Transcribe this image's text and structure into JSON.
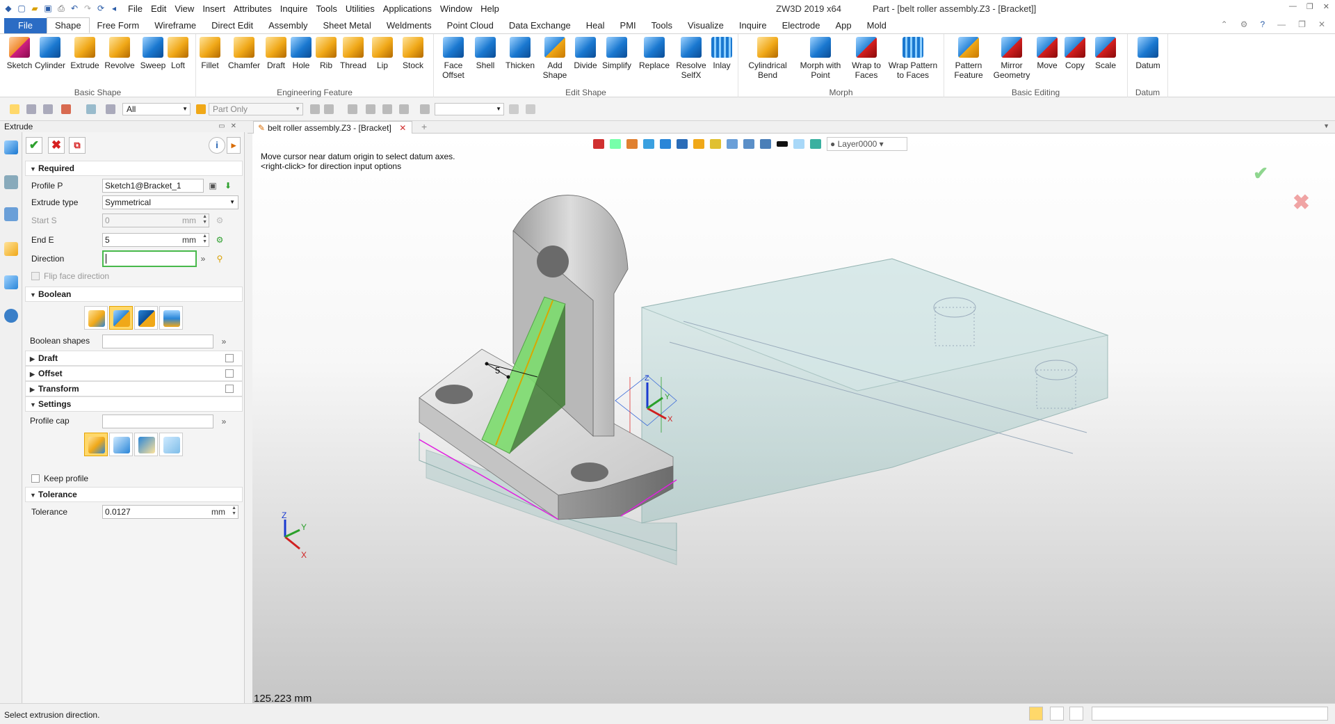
{
  "titlebar": {
    "menus": [
      "File",
      "Edit",
      "View",
      "Insert",
      "Attributes",
      "Inquire",
      "Tools",
      "Utilities",
      "Applications",
      "Window",
      "Help"
    ],
    "app": "ZW3D 2019  x64",
    "document": "Part - [belt roller assembly.Z3 - [Bracket]]"
  },
  "ribbon_tabs": {
    "file": "File",
    "items": [
      "Shape",
      "Free Form",
      "Wireframe",
      "Direct Edit",
      "Assembly",
      "Sheet Metal",
      "Weldments",
      "Point Cloud",
      "Data Exchange",
      "Heal",
      "PMI",
      "Tools",
      "Visualize",
      "Inquire",
      "Electrode",
      "App",
      "Mold"
    ]
  },
  "ribbon": {
    "basic_shape": {
      "label": "Basic Shape",
      "buttons": [
        "Sketch",
        "Cylinder",
        "Extrude",
        "Revolve",
        "Sweep",
        "Loft"
      ]
    },
    "engineering": {
      "label": "Engineering Feature",
      "buttons": [
        "Fillet",
        "Chamfer",
        "Draft",
        "Hole",
        "Rib",
        "Thread",
        "Lip",
        "Stock"
      ]
    },
    "edit_shape": {
      "label": "Edit Shape",
      "buttons": [
        [
          "Face",
          "Offset"
        ],
        [
          "Shell",
          ""
        ],
        [
          "Thicken",
          ""
        ],
        [
          "Add",
          "Shape"
        ],
        [
          "Divide",
          ""
        ],
        [
          "Simplify",
          ""
        ],
        [
          "Replace",
          ""
        ],
        [
          "Resolve",
          "SelfX"
        ],
        [
          "Inlay",
          ""
        ]
      ]
    },
    "morph": {
      "label": "Morph",
      "buttons": [
        [
          "Cylindrical",
          "Bend"
        ],
        [
          "Morph with",
          "Point"
        ],
        [
          "Wrap to",
          "Faces"
        ],
        [
          "Wrap Pattern",
          "to Faces"
        ]
      ]
    },
    "basic_editing": {
      "label": "Basic Editing",
      "buttons": [
        [
          "Pattern",
          "Feature"
        ],
        [
          "Mirror",
          "Geometry"
        ],
        [
          "Move",
          ""
        ],
        [
          "Copy",
          ""
        ],
        [
          "Scale",
          ""
        ]
      ]
    },
    "datum": {
      "label": "Datum",
      "buttons": [
        [
          "Datum",
          ""
        ]
      ]
    }
  },
  "toolbar2": {
    "filter": "All",
    "scope": "Part Only"
  },
  "panel": {
    "title": "Extrude",
    "required": {
      "header": "Required",
      "profile_label": "Profile P",
      "profile_value": "Sketch1@Bracket_1",
      "type_label": "Extrude type",
      "type_value": "Symmetrical",
      "start_label": "Start S",
      "start_value": "0",
      "start_unit": "mm",
      "end_label": "End E",
      "end_value": "5",
      "end_unit": "mm",
      "direction_label": "Direction",
      "direction_value": "",
      "flip_label": "Flip face direction"
    },
    "boolean": {
      "header": "Boolean",
      "shapes_label": "Boolean shapes"
    },
    "draft": "Draft",
    "offset": "Offset",
    "transform": "Transform",
    "settings": {
      "header": "Settings",
      "cap_label": "Profile cap",
      "keep_label": "Keep profile"
    },
    "tolerance": {
      "header": "Tolerance",
      "label": "Tolerance",
      "value": "0.0127",
      "unit": "mm"
    }
  },
  "doc_tab": "belt roller assembly.Z3 - [Bracket]",
  "viewport": {
    "layer": "Layer0000",
    "prompt1": "Move cursor near datum origin to select datum axes.",
    "prompt2": "<right-click> for direction input options",
    "dimension": "5",
    "measure": "125.223 mm",
    "axis_x": "X",
    "axis_y": "Y",
    "axis_z": "Z"
  },
  "status": {
    "text": "Select extrusion direction."
  },
  "colors": {
    "accent": "#2b6cc4",
    "preview_green": "#7ddc6e",
    "edge_magenta": "#e020e0",
    "ok": "#47b94a",
    "cancel": "#d83030"
  }
}
